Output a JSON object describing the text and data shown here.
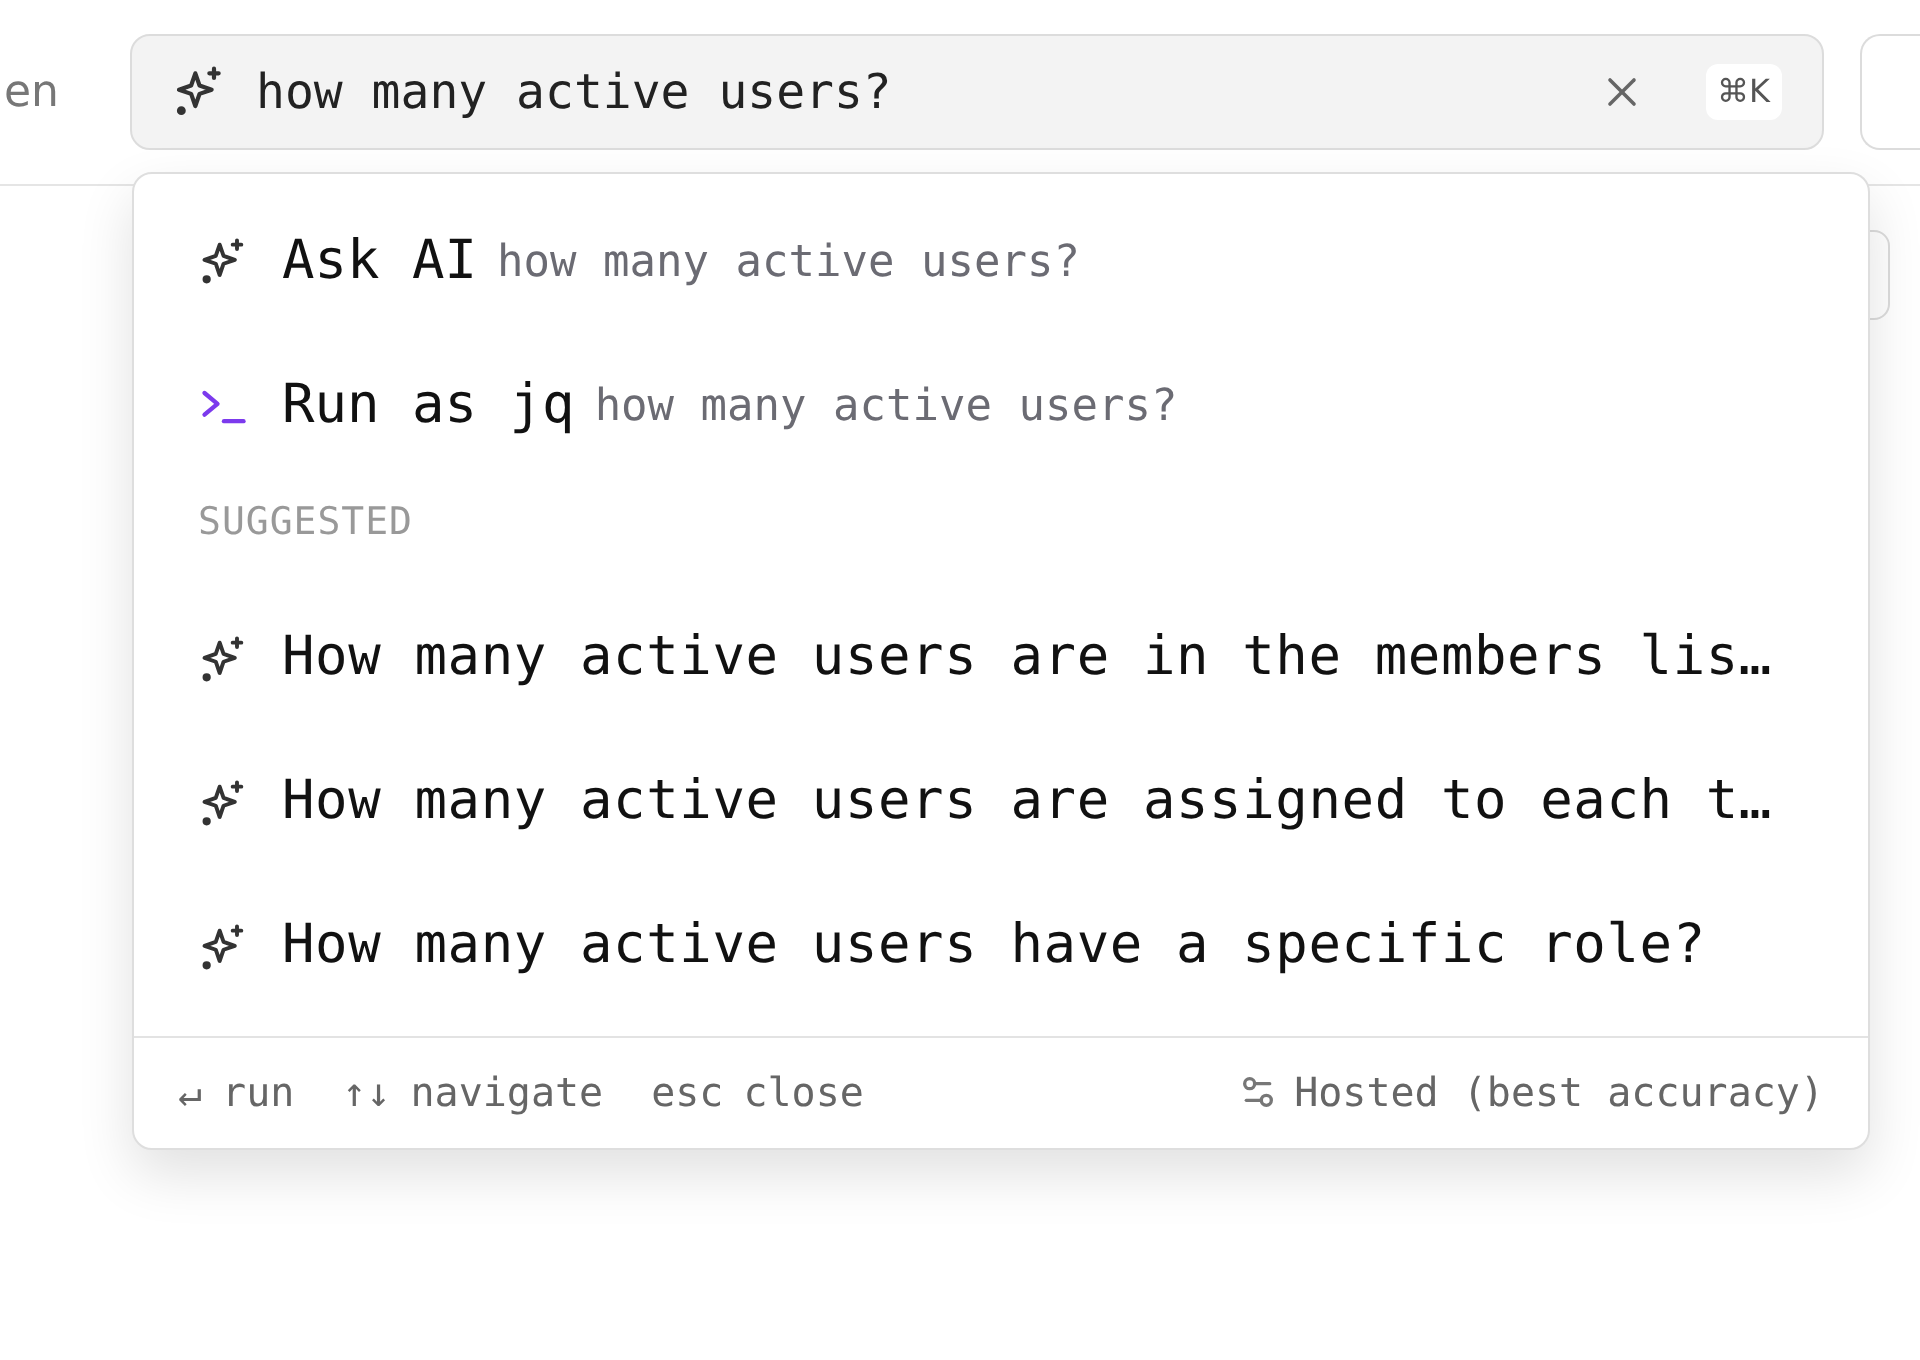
{
  "top_bar": {
    "left_text": "en",
    "search": {
      "value": "how many active users?",
      "shortcut": "⌘K"
    }
  },
  "dropdown": {
    "actions": [
      {
        "kind": "ai",
        "label": "Ask AI",
        "query": "how many active users?"
      },
      {
        "kind": "jq",
        "label": "Run as jq",
        "query": "how many active users?"
      }
    ],
    "section_title": "SUGGESTED",
    "suggestions": [
      "How many active users are in the members lis…",
      "How many active users are assigned to each t…",
      "How many active users have a specific role?"
    ],
    "footer": {
      "hints": [
        {
          "key": "↵",
          "label": "run"
        },
        {
          "key": "↑↓",
          "label": "navigate"
        },
        {
          "key": "esc",
          "label": "close"
        }
      ],
      "mode": "Hosted (best accuracy)"
    }
  }
}
